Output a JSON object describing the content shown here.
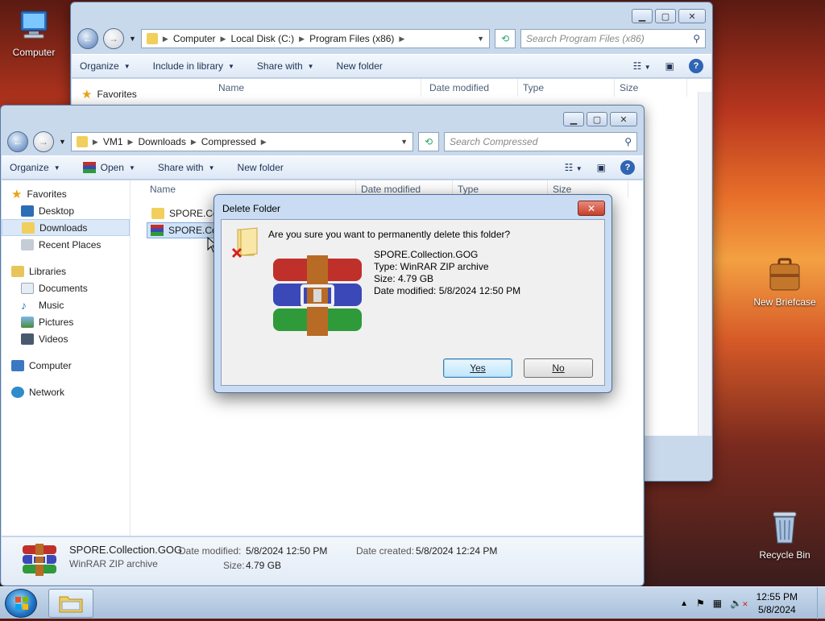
{
  "desktop": {
    "icons": [
      {
        "label": "Computer"
      },
      {
        "label": "New Briefcase"
      },
      {
        "label": "Recycle Bin"
      }
    ]
  },
  "back_window": {
    "address": [
      "Computer",
      "Local Disk (C:)",
      "Program Files (x86)"
    ],
    "search_placeholder": "Search Program Files (x86)",
    "toolbar": [
      "Organize",
      "Include in library",
      "Share with",
      "New folder"
    ],
    "columns": [
      "Name",
      "Date modified",
      "Type",
      "Size"
    ],
    "nav": [
      "Favorites"
    ]
  },
  "front_window": {
    "address": [
      "VM1",
      "Downloads",
      "Compressed"
    ],
    "search_placeholder": "Search Compressed",
    "toolbar": {
      "organize": "Organize",
      "open": "Open",
      "share": "Share with",
      "newfolder": "New folder"
    },
    "columns": [
      "Name",
      "Date modified",
      "Type",
      "Size"
    ],
    "nav": {
      "favorites": "Favorites",
      "desktop": "Desktop",
      "downloads": "Downloads",
      "recent": "Recent Places",
      "libraries": "Libraries",
      "documents": "Documents",
      "music": "Music",
      "pictures": "Pictures",
      "videos": "Videos",
      "computer": "Computer",
      "network": "Network"
    },
    "files": [
      {
        "name": "SPORE.Coll"
      },
      {
        "name": "SPORE.Coll"
      }
    ],
    "details": {
      "name": "SPORE.Collection.GOG",
      "type": "WinRAR ZIP archive",
      "modified_label": "Date modified:",
      "modified": "5/8/2024 12:50 PM",
      "created_label": "Date created:",
      "created": "5/8/2024 12:24 PM",
      "size_label": "Size:",
      "size": "4.79 GB"
    }
  },
  "dialog": {
    "title": "Delete Folder",
    "question": "Are you sure you want to permanently delete this folder?",
    "name": "SPORE.Collection.GOG",
    "type": "Type: WinRAR ZIP archive",
    "size": "Size: 4.79 GB",
    "modified": "Date modified: 5/8/2024 12:50 PM",
    "yes": "Yes",
    "no": "No"
  },
  "taskbar": {
    "time": "12:55 PM",
    "date": "5/8/2024"
  }
}
